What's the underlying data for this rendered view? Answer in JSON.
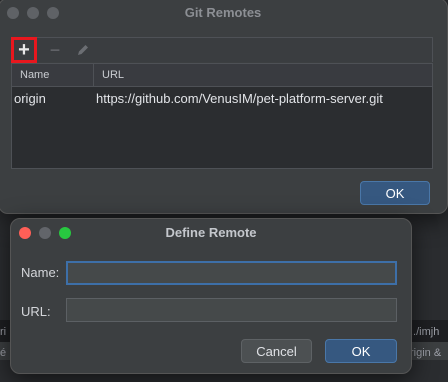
{
  "background": {
    "left_text_1": "ri",
    "left_text_2": "é",
    "right_text_1": "../imjh",
    "right_text_2": "rigin &"
  },
  "git_remotes": {
    "title": "Git Remotes",
    "toolbar": {
      "add_glyph": "+",
      "remove_glyph": "−"
    },
    "table": {
      "columns": [
        "Name",
        "URL"
      ],
      "rows": [
        {
          "name": "origin",
          "url": "https://github.com/VenusIM/pet-platform-server.git"
        }
      ]
    },
    "ok_label": "OK"
  },
  "define_remote": {
    "title": "Define Remote",
    "name_label": "Name:",
    "name_value": "",
    "url_label": "URL:",
    "url_value": "",
    "cancel_label": "Cancel",
    "ok_label": "OK"
  },
  "colors": {
    "accent_button": "#365880",
    "focus_ring": "#3d6fa8",
    "highlight_box": "#e8171e"
  }
}
